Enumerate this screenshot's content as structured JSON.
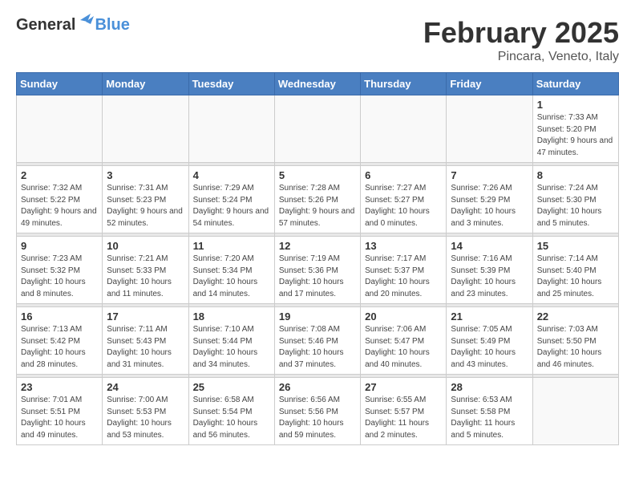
{
  "header": {
    "logo_general": "General",
    "logo_blue": "Blue",
    "title": "February 2025",
    "subtitle": "Pincara, Veneto, Italy"
  },
  "days_of_week": [
    "Sunday",
    "Monday",
    "Tuesday",
    "Wednesday",
    "Thursday",
    "Friday",
    "Saturday"
  ],
  "weeks": [
    [
      {
        "day": "",
        "info": ""
      },
      {
        "day": "",
        "info": ""
      },
      {
        "day": "",
        "info": ""
      },
      {
        "day": "",
        "info": ""
      },
      {
        "day": "",
        "info": ""
      },
      {
        "day": "",
        "info": ""
      },
      {
        "day": "1",
        "info": "Sunrise: 7:33 AM\nSunset: 5:20 PM\nDaylight: 9 hours and 47 minutes."
      }
    ],
    [
      {
        "day": "2",
        "info": "Sunrise: 7:32 AM\nSunset: 5:22 PM\nDaylight: 9 hours and 49 minutes."
      },
      {
        "day": "3",
        "info": "Sunrise: 7:31 AM\nSunset: 5:23 PM\nDaylight: 9 hours and 52 minutes."
      },
      {
        "day": "4",
        "info": "Sunrise: 7:29 AM\nSunset: 5:24 PM\nDaylight: 9 hours and 54 minutes."
      },
      {
        "day": "5",
        "info": "Sunrise: 7:28 AM\nSunset: 5:26 PM\nDaylight: 9 hours and 57 minutes."
      },
      {
        "day": "6",
        "info": "Sunrise: 7:27 AM\nSunset: 5:27 PM\nDaylight: 10 hours and 0 minutes."
      },
      {
        "day": "7",
        "info": "Sunrise: 7:26 AM\nSunset: 5:29 PM\nDaylight: 10 hours and 3 minutes."
      },
      {
        "day": "8",
        "info": "Sunrise: 7:24 AM\nSunset: 5:30 PM\nDaylight: 10 hours and 5 minutes."
      }
    ],
    [
      {
        "day": "9",
        "info": "Sunrise: 7:23 AM\nSunset: 5:32 PM\nDaylight: 10 hours and 8 minutes."
      },
      {
        "day": "10",
        "info": "Sunrise: 7:21 AM\nSunset: 5:33 PM\nDaylight: 10 hours and 11 minutes."
      },
      {
        "day": "11",
        "info": "Sunrise: 7:20 AM\nSunset: 5:34 PM\nDaylight: 10 hours and 14 minutes."
      },
      {
        "day": "12",
        "info": "Sunrise: 7:19 AM\nSunset: 5:36 PM\nDaylight: 10 hours and 17 minutes."
      },
      {
        "day": "13",
        "info": "Sunrise: 7:17 AM\nSunset: 5:37 PM\nDaylight: 10 hours and 20 minutes."
      },
      {
        "day": "14",
        "info": "Sunrise: 7:16 AM\nSunset: 5:39 PM\nDaylight: 10 hours and 23 minutes."
      },
      {
        "day": "15",
        "info": "Sunrise: 7:14 AM\nSunset: 5:40 PM\nDaylight: 10 hours and 25 minutes."
      }
    ],
    [
      {
        "day": "16",
        "info": "Sunrise: 7:13 AM\nSunset: 5:42 PM\nDaylight: 10 hours and 28 minutes."
      },
      {
        "day": "17",
        "info": "Sunrise: 7:11 AM\nSunset: 5:43 PM\nDaylight: 10 hours and 31 minutes."
      },
      {
        "day": "18",
        "info": "Sunrise: 7:10 AM\nSunset: 5:44 PM\nDaylight: 10 hours and 34 minutes."
      },
      {
        "day": "19",
        "info": "Sunrise: 7:08 AM\nSunset: 5:46 PM\nDaylight: 10 hours and 37 minutes."
      },
      {
        "day": "20",
        "info": "Sunrise: 7:06 AM\nSunset: 5:47 PM\nDaylight: 10 hours and 40 minutes."
      },
      {
        "day": "21",
        "info": "Sunrise: 7:05 AM\nSunset: 5:49 PM\nDaylight: 10 hours and 43 minutes."
      },
      {
        "day": "22",
        "info": "Sunrise: 7:03 AM\nSunset: 5:50 PM\nDaylight: 10 hours and 46 minutes."
      }
    ],
    [
      {
        "day": "23",
        "info": "Sunrise: 7:01 AM\nSunset: 5:51 PM\nDaylight: 10 hours and 49 minutes."
      },
      {
        "day": "24",
        "info": "Sunrise: 7:00 AM\nSunset: 5:53 PM\nDaylight: 10 hours and 53 minutes."
      },
      {
        "day": "25",
        "info": "Sunrise: 6:58 AM\nSunset: 5:54 PM\nDaylight: 10 hours and 56 minutes."
      },
      {
        "day": "26",
        "info": "Sunrise: 6:56 AM\nSunset: 5:56 PM\nDaylight: 10 hours and 59 minutes."
      },
      {
        "day": "27",
        "info": "Sunrise: 6:55 AM\nSunset: 5:57 PM\nDaylight: 11 hours and 2 minutes."
      },
      {
        "day": "28",
        "info": "Sunrise: 6:53 AM\nSunset: 5:58 PM\nDaylight: 11 hours and 5 minutes."
      },
      {
        "day": "",
        "info": ""
      }
    ]
  ]
}
